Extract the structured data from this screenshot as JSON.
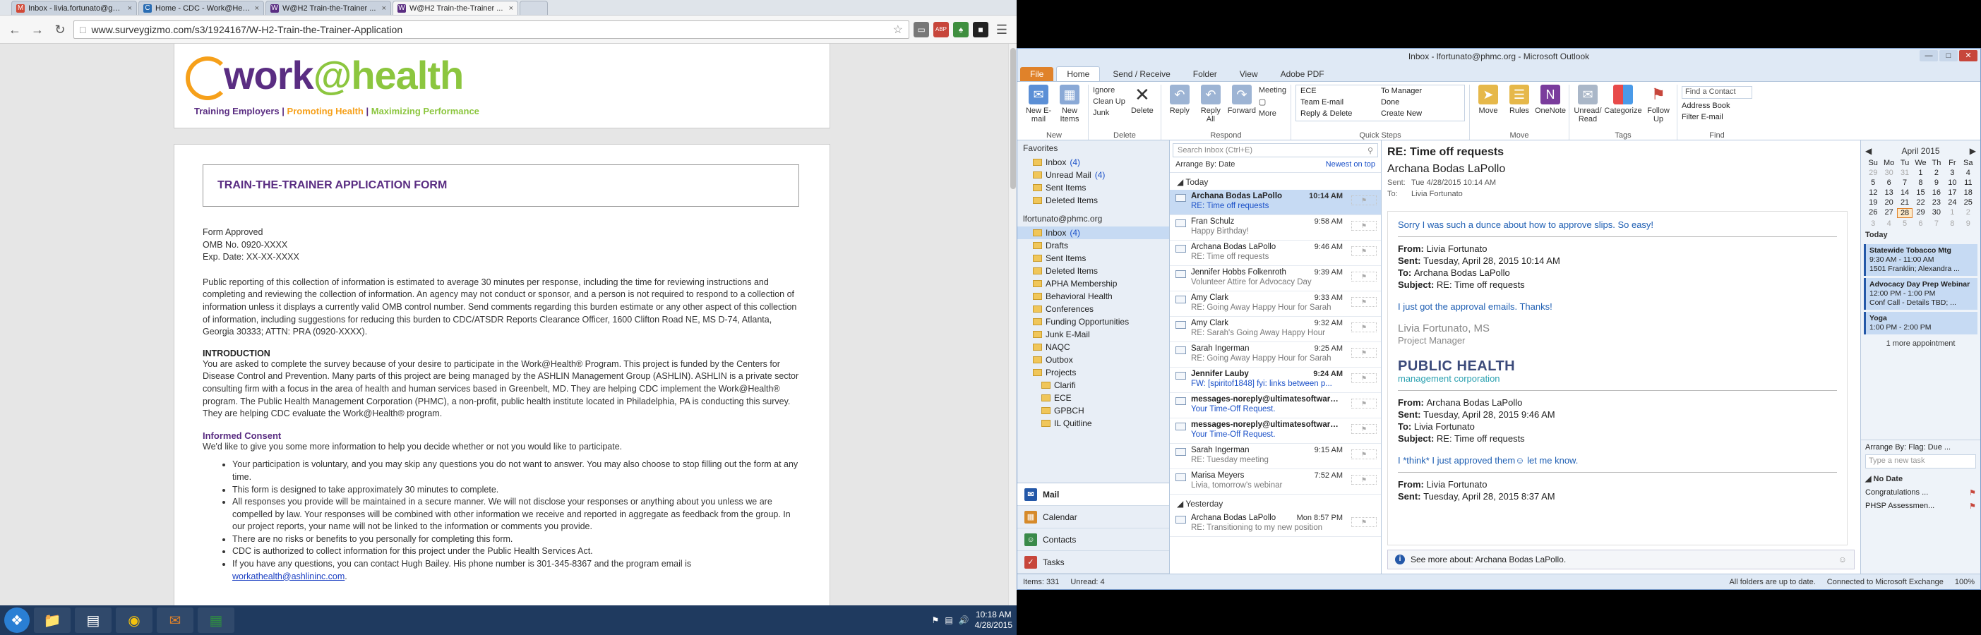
{
  "browser": {
    "tabs": [
      {
        "icon": "M",
        "color": "#d14836",
        "title": "Inbox - livia.fortunato@gm..."
      },
      {
        "icon": "C",
        "color": "#2a6db3",
        "title": "Home - CDC - Work@Hea..."
      },
      {
        "icon": "W",
        "color": "#5a2d82",
        "title": "W@H2 Train-the-Trainer ..."
      },
      {
        "icon": "W",
        "color": "#5a2d82",
        "title": "W@H2 Train-the-Trainer ..."
      }
    ],
    "url": "www.surveygizmo.com/s3/1924167/W-H2-Train-the-Trainer-Application",
    "ext_abp": "ABP"
  },
  "banner": {
    "logo_work": "work",
    "logo_at": "@",
    "logo_health": "health",
    "tag1": "Training Employers",
    "sep1": " | ",
    "tag2": "Promoting Health",
    "sep2": " | ",
    "tag3": "Maximizing Performance"
  },
  "form": {
    "title": "TRAIN-THE-TRAINER APPLICATION FORM",
    "approved": "Form Approved",
    "omb": "OMB No. 0920-XXXX",
    "exp": "Exp. Date: XX-XX-XXXX",
    "burden": "Public reporting of this collection of information is estimated to average 30 minutes per response, including the time for reviewing instructions and completing and reviewing the collection of information. An agency may not conduct or sponsor, and a person is not required to respond to a collection of information unless it displays a currently valid OMB control number. Send comments regarding this burden estimate or any other aspect of this collection of information, including suggestions for reducing this burden to CDC/ATSDR Reports Clearance Officer, 1600 Clifton Road NE, MS D-74, Atlanta, Georgia 30333; ATTN: PRA (0920-XXXX).",
    "intro_heading": "INTRODUCTION",
    "intro": "You are asked to complete the survey because of your desire to participate in the Work@Health® Program.  This project is funded by the Centers for Disease Control and Prevention. Many parts of this project are being managed by the ASHLIN Management Group (ASHLIN). ASHLIN is a private sector consulting firm with a focus in the area of health and human services based in Greenbelt, MD. They are helping CDC implement the Work@Health® program.  The Public Health Management Corporation (PHMC), a non-profit, public health institute located in Philadelphia, PA is conducting this survey.  They are helping CDC evaluate the Work@Health® program.",
    "consent_heading": "Informed Consent",
    "consent_intro": "We'd like to give you some more information to help you decide whether or not you would like to participate.",
    "bullets": [
      "Your participation is voluntary, and you may skip any questions you do not want to answer.  You may also choose to stop filling out the form at any time.",
      "This form is designed to take approximately 30 minutes to complete.",
      "All responses you provide will be maintained in a secure manner. We will not disclose your responses or anything about you unless we are compelled by law. Your responses will be combined with other information we receive and reported in aggregate as feedback from the group. In our project reports, your name will not be linked to the information or comments you provide.",
      "There are no risks or benefits to you personally for completing this form.",
      "CDC is authorized to collect information for this project under the Public Health Services Act."
    ],
    "contact": "If you have any questions, you can contact Hugh Bailey. His phone number is 301-345-8367 and the program email is",
    "email": "workathealth@ashlininc.com",
    "email_period": "."
  },
  "taskbar": {
    "time": "10:18 AM",
    "date": "4/28/2015"
  },
  "outlook": {
    "title": "Inbox - lfortunato@phmc.org - Microsoft Outlook",
    "tabs": [
      "File",
      "Home",
      "Send / Receive",
      "Folder",
      "View",
      "Adobe PDF"
    ],
    "ribbon": {
      "new_email": "New E-mail",
      "new_items": "New Items",
      "group_new": "New",
      "ignore": "Ignore",
      "clean_up": "Clean Up",
      "junk": "Junk",
      "delete": "Delete",
      "group_delete": "Delete",
      "reply": "Reply",
      "reply_all": "Reply All",
      "forward": "Forward",
      "meeting": "Meeting",
      "more": "More",
      "group_respond": "Respond",
      "qs": [
        "ECE",
        "To Manager",
        "Team E-mail",
        "Done",
        "Reply & Delete",
        "Create New"
      ],
      "group_qs": "Quick Steps",
      "move": "Move",
      "rules": "Rules",
      "onenote": "OneNote",
      "group_move": "Move",
      "unread": "Unread/ Read",
      "categorize": "Categorize",
      "follow_up": "Follow Up",
      "group_tags": "Tags",
      "find_contact": "Find a Contact",
      "address_book": "Address Book",
      "filter_email": "Filter E-mail",
      "group_find": "Find"
    },
    "nav": {
      "favorites": "Favorites",
      "fav_items": [
        {
          "label": "Inbox",
          "count": "(4)"
        },
        {
          "label": "Unread Mail",
          "count": "(4)"
        },
        {
          "label": "Sent Items",
          "count": ""
        },
        {
          "label": "Deleted Items",
          "count": ""
        }
      ],
      "account": "lfortunato@phmc.org",
      "acct_items": [
        {
          "label": "Inbox",
          "count": "(4)"
        },
        {
          "label": "Drafts",
          "count": ""
        },
        {
          "label": "Sent Items",
          "count": ""
        },
        {
          "label": "Deleted Items",
          "count": ""
        },
        {
          "label": "APHA Membership",
          "count": ""
        },
        {
          "label": "Behavioral Health",
          "count": ""
        },
        {
          "label": "Conferences",
          "count": ""
        },
        {
          "label": "Funding Opportunities",
          "count": ""
        },
        {
          "label": "Junk E-Mail",
          "count": ""
        },
        {
          "label": "NAQC",
          "count": ""
        },
        {
          "label": "Outbox",
          "count": ""
        },
        {
          "label": "Projects",
          "count": ""
        }
      ],
      "project_items": [
        "Clarifi",
        "ECE",
        "GPBCH",
        "IL Quitline"
      ],
      "modules": [
        "Mail",
        "Calendar",
        "Contacts",
        "Tasks"
      ]
    },
    "list": {
      "search_placeholder": "Search Inbox (Ctrl+E)",
      "arrange": "Arrange By: Date",
      "order": "Newest on top",
      "group_today": "Today",
      "group_yesterday": "Yesterday",
      "messages": [
        {
          "from": "Archana Bodas LaPollo",
          "time": "10:14 AM",
          "subject": "RE: Time off requests",
          "unread": true,
          "selected": true
        },
        {
          "from": "Fran Schulz",
          "time": "9:58 AM",
          "subject": "Happy Birthday!",
          "unread": false,
          "selected": false
        },
        {
          "from": "Archana Bodas LaPollo",
          "time": "9:46 AM",
          "subject": "RE: Time off requests",
          "unread": false,
          "selected": false
        },
        {
          "from": "Jennifer Hobbs  Folkenroth",
          "time": "9:39 AM",
          "subject": "Volunteer Attire for Advocacy Day",
          "unread": false,
          "selected": false
        },
        {
          "from": "Amy Clark",
          "time": "9:33 AM",
          "subject": "RE: Going Away Happy Hour for Sarah",
          "unread": false,
          "selected": false
        },
        {
          "from": "Amy Clark",
          "time": "9:32 AM",
          "subject": "RE: Sarah's Going Away Happy Hour",
          "unread": false,
          "selected": false
        },
        {
          "from": "Sarah Ingerman",
          "time": "9:25 AM",
          "subject": "RE: Going Away Happy Hour for Sarah",
          "unread": false,
          "selected": false
        },
        {
          "from": "Jennifer Lauby",
          "time": "9:24 AM",
          "subject": "FW: [spiritof1848] fyi: links between p...",
          "unread": true,
          "selected": false
        },
        {
          "from": "messages-noreply@ultimatesoftware....",
          "time": "",
          "subject": "Your Time-Off Request.",
          "unread": true,
          "selected": false
        },
        {
          "from": "messages-noreply@ultimatesoftware....",
          "time": "",
          "subject": "Your Time-Off Request.",
          "unread": true,
          "selected": false
        },
        {
          "from": "Sarah Ingerman",
          "time": "9:15 AM",
          "subject": "RE: Tuesday meeting",
          "unread": false,
          "selected": false
        },
        {
          "from": "Marisa Meyers",
          "time": "7:52 AM",
          "subject": "Livia, tomorrow's webinar",
          "unread": false,
          "selected": false
        }
      ],
      "yesterday_msg": {
        "from": "Archana Bodas LaPollo",
        "time": "Mon 8:57 PM",
        "subject": "RE: Transitioning to my new position"
      }
    },
    "reading": {
      "subject": "RE: Time off requests",
      "from": "Archana Bodas LaPollo",
      "sent_label": "Sent:",
      "sent": "Tue 4/28/2015 10:14 AM",
      "to_label": "To:",
      "to": "Livia Fortunato",
      "line1": "Sorry I was such a dunce about how to approve slips. So easy!",
      "h1_from": "Livia Fortunato",
      "h1_sent": "Tuesday, April 28, 2015 10:14 AM",
      "h1_to": "Archana Bodas LaPollo",
      "h1_subject": "RE: Time off requests",
      "line2": "I just got the approval emails. Thanks!",
      "sig_name": "Livia Fortunato, MS",
      "sig_title": "Project Manager",
      "sig_org1": "PUBLIC HEALTH",
      "sig_org2": "management corporation",
      "h2_from": "Archana Bodas LaPollo",
      "h2_sent": "Tuesday, April 28, 2015 9:46 AM",
      "h2_to": "Livia Fortunato",
      "h2_subject": "RE: Time off requests",
      "line3": "I *think* I just approved them☺ let me know.",
      "h3_from": "Livia Fortunato",
      "h3_sent": "Tuesday, April 28, 2015 8:37 AM",
      "lbl_from": "From:",
      "lbl_sent": "Sent:",
      "lbl_to": "To:",
      "lbl_subject": "Subject:",
      "people_pane": "See more about: Archana Bodas LaPollo."
    },
    "todo": {
      "month": "April 2015",
      "weekdays": [
        "Su",
        "Mo",
        "Tu",
        "We",
        "Th",
        "Fr",
        "Sa"
      ],
      "days": [
        "29",
        "30",
        "31",
        "1",
        "2",
        "3",
        "4",
        "5",
        "6",
        "7",
        "8",
        "9",
        "10",
        "11",
        "12",
        "13",
        "14",
        "15",
        "16",
        "17",
        "18",
        "19",
        "20",
        "21",
        "22",
        "23",
        "24",
        "25",
        "26",
        "27",
        "28",
        "29",
        "30",
        "1",
        "2",
        "3",
        "4",
        "5",
        "6",
        "7",
        "8",
        "9"
      ],
      "today_label": "Today",
      "appointments": [
        {
          "title": "Statewide Tobacco Mtg",
          "time": "9:30 AM - 11:00 AM",
          "where": "1501 Franklin; Alexandra ..."
        },
        {
          "title": "Advocacy Day Prep Webinar",
          "time": "12:00 PM - 1:00 PM",
          "where": "Conf Call - Details TBD; ..."
        },
        {
          "title": "Yoga",
          "time": "1:00 PM - 2:00 PM",
          "where": ""
        }
      ],
      "more_appt": "1 more appointment",
      "arrange": "Arrange By: Flag: Due ...",
      "new_task": "Type a new task",
      "no_date": "No Date",
      "tasks": [
        "Congratulations ...",
        "PHSP Assessmen..."
      ]
    },
    "status": {
      "items": "Items: 331",
      "unread": "Unread: 4",
      "folders": "All folders are up to date.",
      "connected": "Connected to Microsoft Exchange",
      "zoom": "100%"
    }
  }
}
